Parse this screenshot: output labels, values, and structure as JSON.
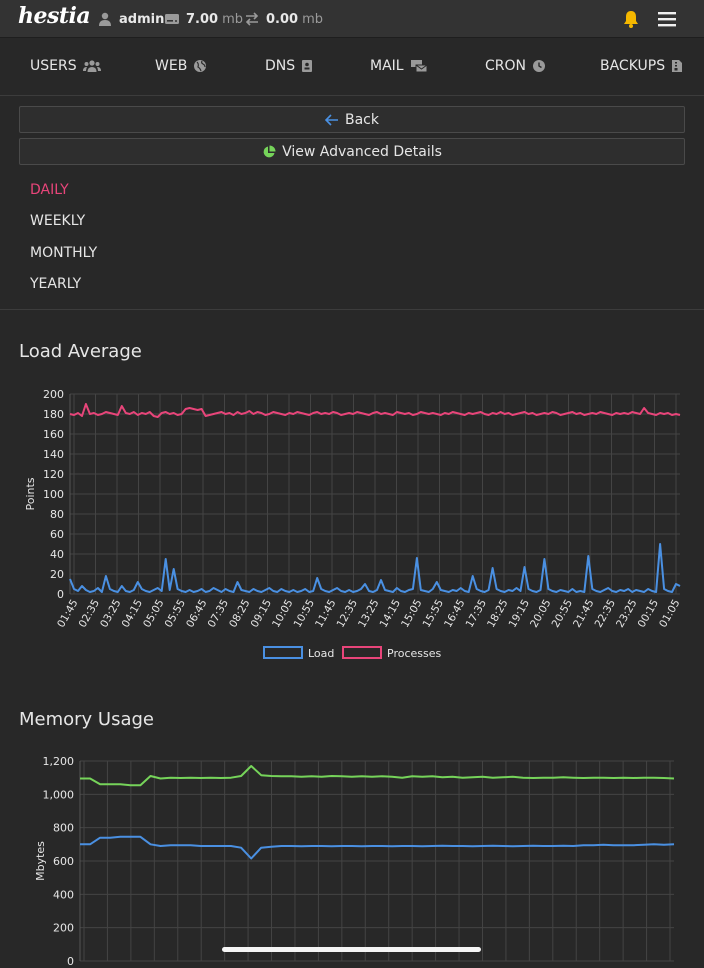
{
  "topbar": {
    "logo": "hestia",
    "user": "admin",
    "disk_value": "7.00",
    "disk_unit": "mb",
    "bandwidth_value": "0.00",
    "bandwidth_unit": "mb"
  },
  "tabs": [
    {
      "label": "USERS",
      "icon": "users-icon"
    },
    {
      "label": "WEB",
      "icon": "globe-icon"
    },
    {
      "label": "DNS",
      "icon": "address-book-icon"
    },
    {
      "label": "MAIL",
      "icon": "mail-bulk-icon"
    },
    {
      "label": "CRON",
      "icon": "clock-icon"
    },
    {
      "label": "BACKUPS",
      "icon": "file-archive-icon"
    }
  ],
  "buttons": {
    "back": "Back",
    "advanced": "View Advanced Details"
  },
  "periods": [
    {
      "label": "DAILY",
      "active": true
    },
    {
      "label": "WEEKLY",
      "active": false
    },
    {
      "label": "MONTHLY",
      "active": false
    },
    {
      "label": "YEARLY",
      "active": false
    }
  ],
  "colors": {
    "accent": "#e8457a",
    "load": "#4a90e2",
    "processes": "#e8457a",
    "memory_a": "#76d45a",
    "memory_b": "#4a90e2",
    "bell": "#f5b800",
    "pie": "#76d45a"
  },
  "chart_data": [
    {
      "type": "line",
      "title": "Load Average",
      "ylabel": "Points",
      "ylim": [
        0,
        200
      ],
      "yticks": [
        0,
        20,
        40,
        60,
        80,
        100,
        120,
        140,
        160,
        180,
        200
      ],
      "x_tick_labels": [
        "01:45",
        "02:35",
        "03:25",
        "04:15",
        "05:05",
        "05:55",
        "06:45",
        "07:35",
        "08:25",
        "09:15",
        "10:05",
        "10:55",
        "11:45",
        "12:35",
        "13:25",
        "14:15",
        "15:05",
        "15:55",
        "16:45",
        "17:35",
        "18:25",
        "19:15",
        "20:05",
        "20:55",
        "21:45",
        "22:35",
        "23:25",
        "00:15",
        "01:05"
      ],
      "grid": true,
      "legend": "bottom",
      "series": [
        {
          "name": "Load",
          "values": [
            15,
            5,
            3,
            8,
            4,
            2,
            3,
            6,
            2,
            18,
            5,
            3,
            2,
            8,
            3,
            2,
            4,
            12,
            5,
            3,
            2,
            4,
            6,
            3,
            35,
            4,
            25,
            5,
            3,
            2,
            4,
            2,
            3,
            5,
            2,
            3,
            6,
            4,
            2,
            5,
            3,
            2,
            12,
            4,
            3,
            2,
            5,
            3,
            2,
            4,
            6,
            3,
            2,
            5,
            3,
            2,
            4,
            2,
            3,
            5,
            2,
            3,
            16,
            5,
            3,
            2,
            4,
            6,
            3,
            2,
            4,
            2,
            3,
            5,
            10,
            3,
            2,
            4,
            14,
            4,
            3,
            2,
            6,
            3,
            2,
            4,
            5,
            36,
            4,
            3,
            2,
            5,
            12,
            4,
            3,
            2,
            4,
            3,
            6,
            3,
            2,
            18,
            5,
            3,
            2,
            4,
            26,
            5,
            3,
            2,
            4,
            3,
            6,
            3,
            27,
            5,
            3,
            2,
            4,
            35,
            5,
            3,
            2,
            4,
            3,
            2,
            5,
            2,
            3,
            2,
            38,
            5,
            3,
            2,
            4,
            6,
            3,
            2,
            4,
            3,
            5,
            2,
            4,
            3,
            2,
            5,
            3,
            2,
            50,
            5,
            3,
            2,
            10,
            8
          ]
        },
        {
          "name": "Processes",
          "values": [
            180,
            179,
            181,
            178,
            190,
            180,
            181,
            179,
            180,
            182,
            181,
            180,
            179,
            188,
            181,
            180,
            182,
            179,
            181,
            180,
            182,
            178,
            177,
            181,
            182,
            180,
            181,
            179,
            180,
            185,
            186,
            185,
            184,
            185,
            178,
            179,
            180,
            181,
            182,
            180,
            181,
            179,
            182,
            180,
            181,
            183,
            180,
            182,
            181,
            179,
            180,
            182,
            181,
            180,
            179,
            181,
            180,
            182,
            181,
            180,
            179,
            181,
            182,
            180,
            181,
            180,
            182,
            181,
            179,
            180,
            181,
            180,
            182,
            181,
            180,
            179,
            181,
            182,
            180,
            181,
            180,
            179,
            182,
            181,
            180,
            181,
            179,
            180,
            182,
            181,
            180,
            181,
            180,
            179,
            181,
            180,
            182,
            181,
            180,
            179,
            181,
            180,
            181,
            182,
            180,
            179,
            181,
            180,
            182,
            180,
            181,
            179,
            180,
            181,
            182,
            180,
            181,
            179,
            180,
            181,
            180,
            182,
            181,
            179,
            180,
            181,
            182,
            180,
            181,
            179,
            180,
            181,
            180,
            182,
            181,
            180,
            179,
            181,
            180,
            181,
            180,
            182,
            181,
            180,
            186,
            181,
            180,
            179,
            181,
            180,
            181,
            179,
            180,
            179
          ]
        }
      ]
    },
    {
      "type": "line",
      "title": "Memory Usage",
      "ylabel": "Mbytes",
      "ylim": [
        0,
        1200
      ],
      "yticks": [
        0,
        200,
        400,
        600,
        800,
        "1,000",
        "1,200"
      ],
      "grid": true,
      "series": [
        {
          "values": [
            1095,
            1095,
            1060,
            1060,
            1060,
            1055,
            1055,
            1110,
            1095,
            1100,
            1098,
            1100,
            1098,
            1100,
            1098,
            1100,
            1110,
            1170,
            1115,
            1110,
            1108,
            1108,
            1105,
            1108,
            1105,
            1110,
            1108,
            1105,
            1108,
            1105,
            1108,
            1105,
            1100,
            1108,
            1105,
            1108,
            1102,
            1105,
            1100,
            1103,
            1105,
            1100,
            1103,
            1105,
            1100,
            1098,
            1100,
            1100,
            1102,
            1100,
            1098,
            1100,
            1100,
            1098,
            1100,
            1098,
            1100,
            1100,
            1098,
            1095
          ]
        },
        {
          "values": [
            700,
            700,
            740,
            740,
            745,
            745,
            745,
            700,
            690,
            695,
            695,
            695,
            690,
            690,
            690,
            690,
            680,
            615,
            680,
            685,
            690,
            690,
            688,
            690,
            690,
            688,
            690,
            690,
            688,
            690,
            690,
            688,
            690,
            690,
            688,
            690,
            692,
            690,
            690,
            688,
            690,
            692,
            690,
            688,
            690,
            692,
            690,
            690,
            692,
            690,
            695,
            695,
            698,
            695,
            695,
            695,
            698,
            700,
            698,
            700
          ]
        }
      ]
    }
  ]
}
